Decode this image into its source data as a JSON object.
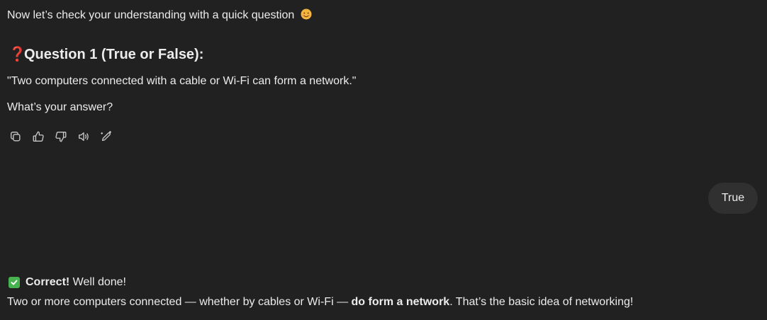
{
  "intro": {
    "text": "Now let’s check your understanding with a quick question",
    "emoji": "smiling-face"
  },
  "question": {
    "icon": "red-question-mark",
    "title": "Question 1 (True or False):",
    "statement": "\"Two computers connected with a cable or Wi-Fi can form a network.\"",
    "prompt": "What’s your answer?"
  },
  "actions": [
    {
      "name": "copy",
      "icon": "copy-icon"
    },
    {
      "name": "good-response",
      "icon": "thumbs-up-icon"
    },
    {
      "name": "bad-response",
      "icon": "thumbs-down-icon"
    },
    {
      "name": "read-aloud",
      "icon": "speaker-icon"
    },
    {
      "name": "edit",
      "icon": "edit-pen-icon"
    }
  ],
  "user_message": {
    "text": "True"
  },
  "reply": {
    "icon": "green-check-box",
    "correct_label": "Correct!",
    "correct_rest": " Well done!",
    "explain_part1": "Two or more computers connected — whether by cables or Wi-Fi — ",
    "explain_bold": "do form a network",
    "explain_part2": ". That’s the basic idea of networking!"
  },
  "colors": {
    "background": "#212121",
    "text": "#ececec",
    "bubble": "#303030",
    "check_green": "#47b34f",
    "question_red": "#e0245e"
  }
}
